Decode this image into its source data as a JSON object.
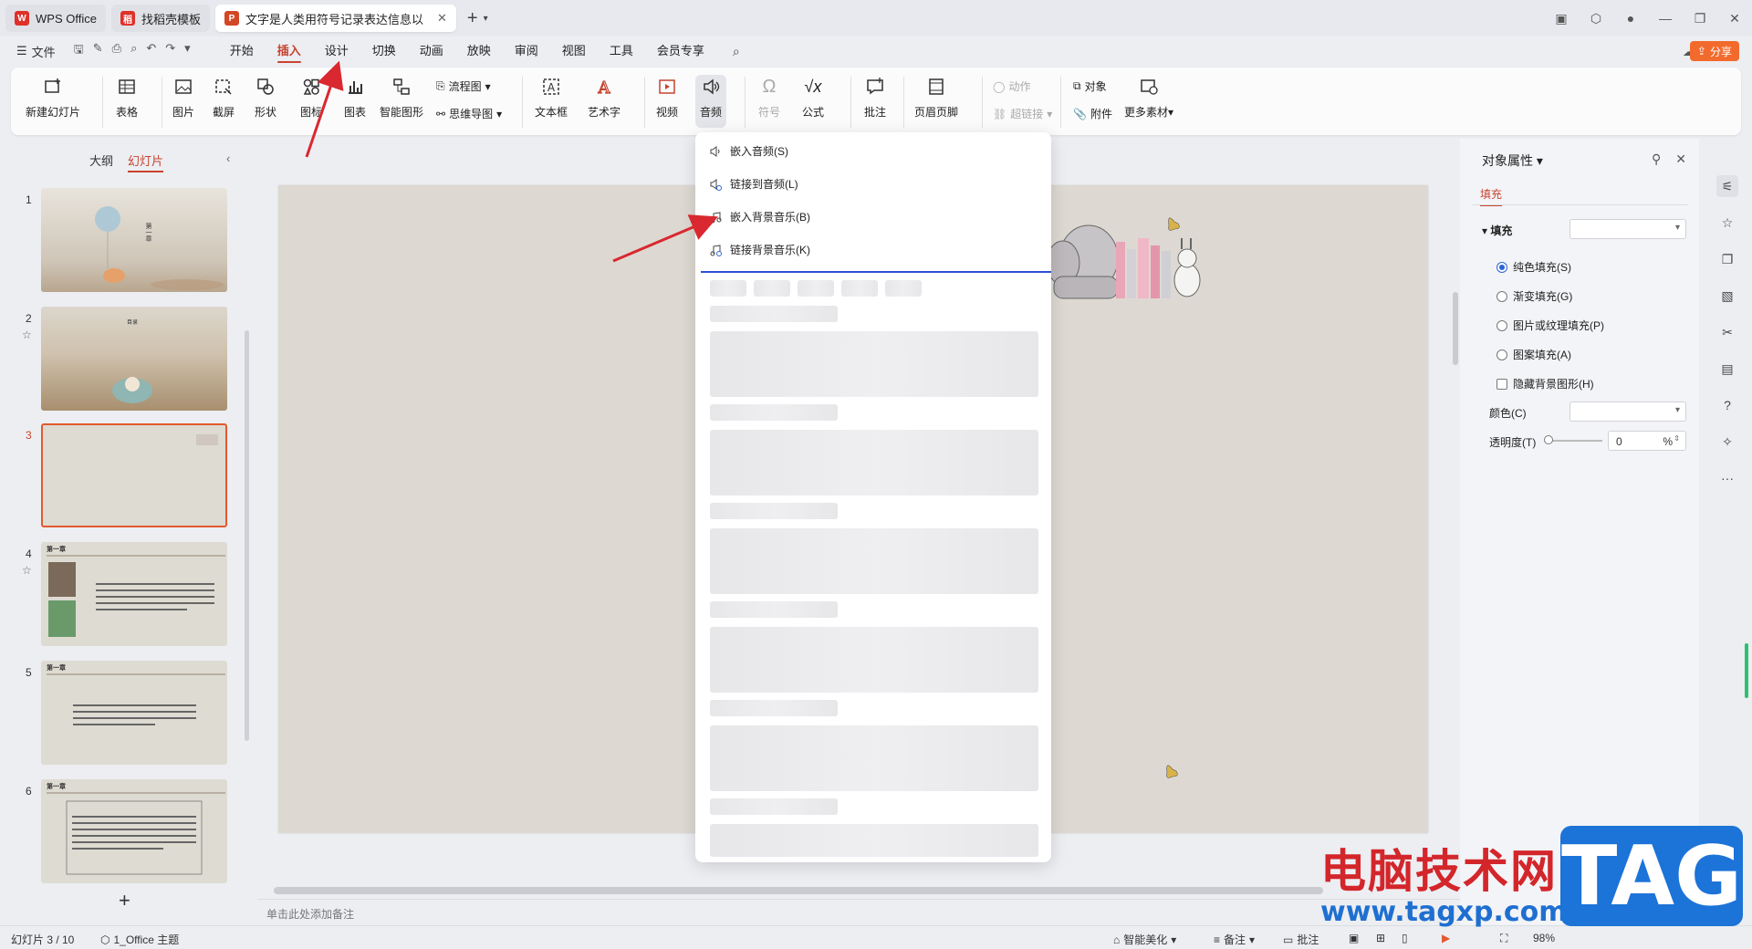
{
  "tabs": [
    {
      "label": "WPS Office",
      "icon": "wps-logo-icon",
      "color": "#e0302a"
    },
    {
      "label": "找稻壳模板",
      "icon": "daoke-logo-icon",
      "color": "#e0302a"
    },
    {
      "label": "文字是人类用符号记录表达信息以",
      "icon": "ppt-logo-icon",
      "color": "#d24726"
    }
  ],
  "menubar": {
    "file": "文件",
    "items": [
      "开始",
      "插入",
      "设计",
      "切换",
      "动画",
      "放映",
      "审阅",
      "视图",
      "工具",
      "会员专享"
    ],
    "active": "插入",
    "share": "分享"
  },
  "ribbon": {
    "new_slide": "新建幻灯片",
    "table": "表格",
    "picture": "图片",
    "screenshot": "截屏",
    "shape": "形状",
    "icon": "图标",
    "chart": "图表",
    "smart_graphic": "智能图形",
    "flowchart": "流程图",
    "mindmap": "思维导图",
    "textbox": "文本框",
    "art_text": "艺术字",
    "video": "视频",
    "audio": "音频",
    "symbol": "符号",
    "formula": "公式",
    "comment": "批注",
    "header_footer": "页眉页脚",
    "action": "动作",
    "hyperlink": "超链接",
    "object": "对象",
    "attachment": "附件",
    "more_material": "更多素材"
  },
  "left_panel": {
    "tab_outline": "大纲",
    "tab_slides": "幻灯片",
    "slides": [
      "1",
      "2",
      "3",
      "4",
      "5",
      "6"
    ],
    "selected_slide": "3",
    "slide1_text": "第一章",
    "slide2_text": "目录",
    "slide4_title": "第一章",
    "slide5_title": "第一章",
    "slide6_title": "第一章"
  },
  "audio_menu": {
    "items": [
      "嵌入音频(S)",
      "链接到音频(L)",
      "嵌入背景音乐(B)",
      "链接背景音乐(K)"
    ]
  },
  "notes": {
    "placeholder": "单击此处添加备注"
  },
  "right_panel": {
    "title": "对象属性",
    "tab": "填充",
    "fill_label": "填充",
    "options": [
      "纯色填充(S)",
      "渐变填充(G)",
      "图片或纹理填充(P)",
      "图案填充(A)"
    ],
    "selected_option": "纯色填充(S)",
    "hide_bg": "隐藏背景图形(H)",
    "color_label": "颜色(C)",
    "transparency_label": "透明度(T)",
    "transparency_value": "0",
    "percent": "%"
  },
  "statusbar": {
    "slide_info": "幻灯片 3 / 10",
    "theme": "1_Office 主题",
    "smart_beautify": "智能美化",
    "notes": "备注",
    "comment": "批注",
    "zoom": "98%"
  },
  "watermark": {
    "text": "电脑技术网",
    "url": "www.tagxp.com",
    "tag": "TAG"
  }
}
